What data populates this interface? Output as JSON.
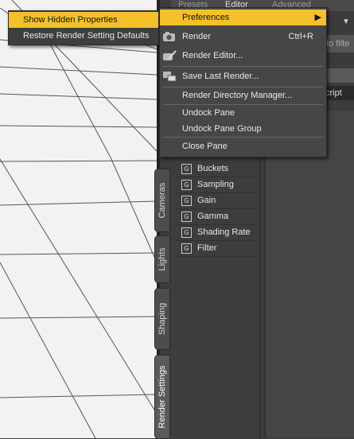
{
  "panel": {
    "tabs": [
      "Presets",
      "Editor",
      "Advanced"
    ],
    "filter_placeholder": "to filte",
    "script_label": "cript"
  },
  "vertical_tabs": [
    "Cameras",
    "Lights",
    "Shaping",
    "Render Settings"
  ],
  "properties": [
    "Buckets",
    "Sampling",
    "Gain",
    "Gamma",
    "Shading Rate",
    "Filter"
  ],
  "property_icon_glyph": "G",
  "submenu": {
    "items": [
      "Show Hidden Properties",
      "Restore Render Setting Defaults"
    ]
  },
  "menu": {
    "preferences": "Preferences",
    "render": "Render",
    "render_shortcut": "Ctrl+R",
    "render_editor": "Render Editor...",
    "save_last_render": "Save Last Render...",
    "render_dir_manager": "Render Directory Manager...",
    "undock_pane": "Undock Pane",
    "undock_pane_group": "Undock Pane Group",
    "close_pane": "Close Pane",
    "arrow": "▶"
  },
  "colors": {
    "highlight": "#f5c12b",
    "menu_bg": "#464646",
    "viewport_bg": "#f2f2f2"
  }
}
